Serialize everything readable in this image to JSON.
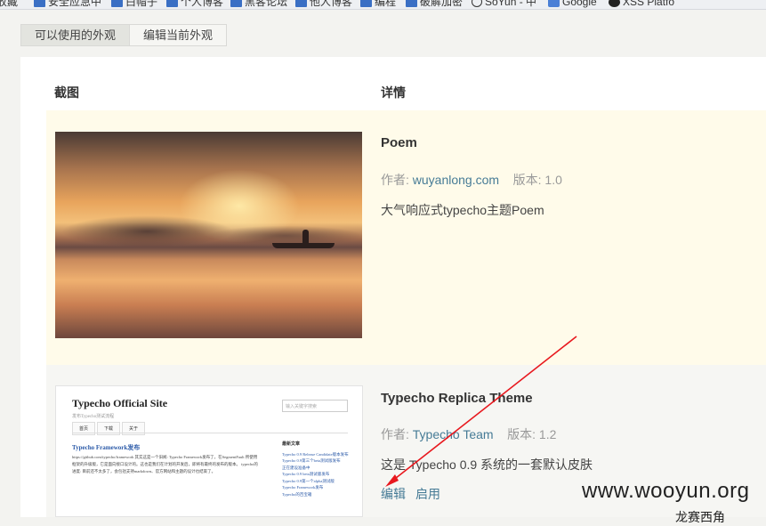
{
  "bookmarks": [
    {
      "label": "收藏",
      "icon": "none"
    },
    {
      "label": "安全应急中",
      "icon": "folder-icon"
    },
    {
      "label": "白帽子",
      "icon": "folder-icon"
    },
    {
      "label": "个人博客",
      "icon": "folder-icon"
    },
    {
      "label": "黑客论坛",
      "icon": "folder-icon"
    },
    {
      "label": "他人博客",
      "icon": "folder-icon"
    },
    {
      "label": "编程",
      "icon": "folder-icon"
    },
    {
      "label": "破解加密",
      "icon": "folder-icon"
    },
    {
      "label": "SoYun - 中",
      "icon": "search-icon"
    },
    {
      "label": "Google",
      "icon": "google-icon"
    },
    {
      "label": "XSS Platfo",
      "icon": "xss-icon"
    }
  ],
  "tabs": [
    "可以使用的外观",
    "编辑当前外观"
  ],
  "table": {
    "headers": {
      "screenshot": "截图",
      "details": "详情"
    }
  },
  "themes": [
    {
      "name": "Poem",
      "author_label": "作者:",
      "author": "wuyanlong.com",
      "version_label": "版本:",
      "version": "1.0",
      "description": "大气响应式typecho主题Poem"
    },
    {
      "name": "Typecho Replica Theme",
      "author_label": "作者:",
      "author": "Typecho Team",
      "version_label": "版本:",
      "version": "1.2",
      "description": "这是 Typecho 0.9 系统的一套默认皮肤",
      "actions": [
        "编辑",
        "启用"
      ],
      "preview": {
        "site_title": "Typecho Official Site",
        "site_subtitle": "发布Typecho测试流程",
        "search_placeholder": "输入关键字搜索",
        "nav": [
          "首页",
          "下载",
          "关于"
        ],
        "post_title": "Typecho Framework发布",
        "post_body": "https://github.com/typecho/framework 其实这是一个旧闻: Typecho Framework发布了，在SegmentFault 所使用框架的升级版，它是面向接口设计的。这也是我们在计划的开发后，即将有最终的发布的版本。 typecho的进度: 目前还不太多了，会包括支持markdown、官方网站和主题的设计也结束了。",
        "sidebar_title": "最新文章",
        "sidebar_items": [
          "Typecho 0.9 Release Candidate版本发布",
          "Typecho 0.9第三个beta测试版发布",
          "正在建设准备中",
          "Typecho 0.9 beta测试版发布",
          "Typecho 0.9第一个alpha测试版",
          "Typecho Framework发布",
          "Typecho的百宝箱"
        ]
      }
    }
  ],
  "watermark": "www.wooyun.org",
  "watermark_sub": "龙赛西角"
}
